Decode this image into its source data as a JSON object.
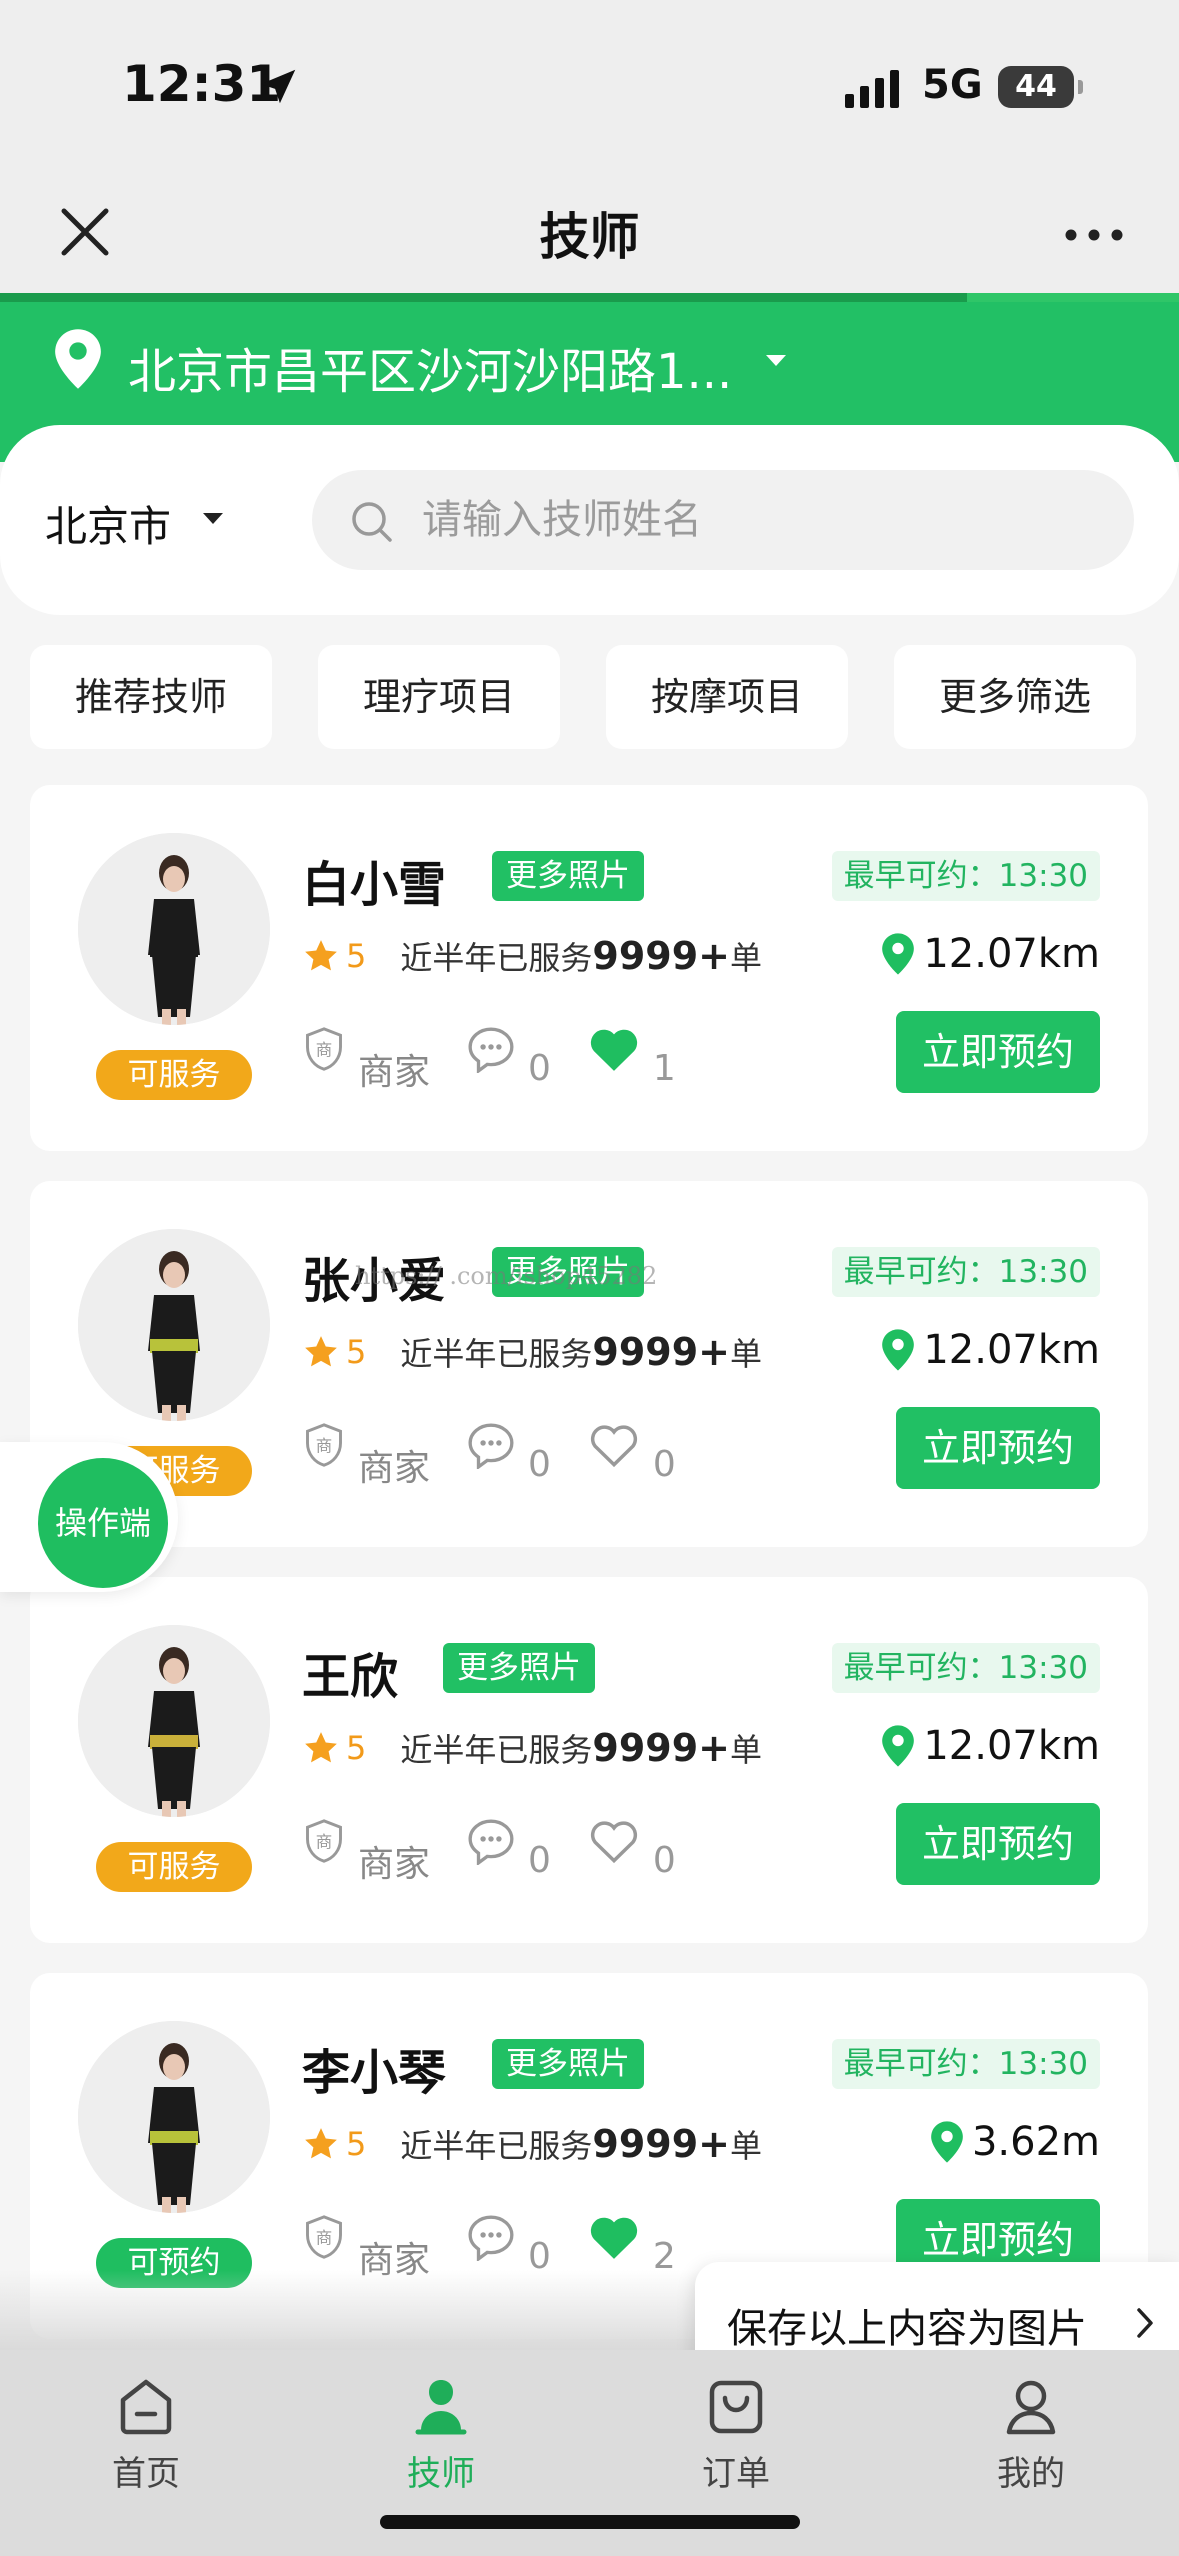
{
  "status_bar": {
    "time": "12:31",
    "network": "5G",
    "battery": "44"
  },
  "nav": {
    "title": "技师",
    "load_progress": 0.82
  },
  "location": {
    "address": "北京市昌平区沙河沙阳路1..."
  },
  "search": {
    "city": "北京市",
    "placeholder": "请输入技师姓名"
  },
  "filters": [
    "推荐技师",
    "理疗项目",
    "按摩项目",
    "更多筛选"
  ],
  "therapists": [
    {
      "name": "白小雪",
      "photo_tag": "更多照片",
      "earliest": "最早可约：13:30",
      "rating": "5",
      "served_prefix": "近半年已服务",
      "served_count": "9999+",
      "served_suffix": "单",
      "distance": "12.07km",
      "shop_label": "商家",
      "comments": "0",
      "likes": "1",
      "liked": true,
      "status": "可服务",
      "book_label": "立即预约",
      "colors": {
        "top": "#1b1b1b",
        "sash": "#1b1b1b"
      }
    },
    {
      "name": "张小爱",
      "photo_tag": "更多照片",
      "earliest": "最早可约：13:30",
      "rating": "5",
      "served_prefix": "近半年已服务",
      "served_count": "9999+",
      "served_suffix": "单",
      "distance": "12.07km",
      "shop_label": "商家",
      "comments": "0",
      "likes": "0",
      "liked": false,
      "status": "可服务",
      "book_label": "立即预约",
      "colors": {
        "top": "#1b1b1b",
        "sash": "#b8c23a"
      }
    },
    {
      "name": "王欣",
      "photo_tag": "更多照片",
      "earliest": "最早可约：13:30",
      "rating": "5",
      "served_prefix": "近半年已服务",
      "served_count": "9999+",
      "served_suffix": "单",
      "distance": "12.07km",
      "shop_label": "商家",
      "comments": "0",
      "likes": "0",
      "liked": false,
      "status": "可服务",
      "book_label": "立即预约",
      "colors": {
        "top": "#1b1b1b",
        "sash": "#c9b03a"
      }
    },
    {
      "name": "李小琴",
      "photo_tag": "更多照片",
      "earliest": "最早可约：13:30",
      "rating": "5",
      "served_prefix": "近半年已服务",
      "served_count": "9999+",
      "served_suffix": "单",
      "distance": "3.62m",
      "shop_label": "商家",
      "comments": "0",
      "likes": "2",
      "liked": true,
      "status": "可预约",
      "book_label": "立即预约",
      "colors": {
        "top": "#1b1b1b",
        "sash": "#b8c23a"
      }
    }
  ],
  "watermark": "https://        .com/ishop45282",
  "floating": {
    "operator": "操作端",
    "save_tip": "保存以上内容为图片"
  },
  "tabs": [
    {
      "label": "首页",
      "icon": "home-icon",
      "active": false
    },
    {
      "label": "技师",
      "icon": "therapist-icon",
      "active": true
    },
    {
      "label": "订单",
      "icon": "order-bag-icon",
      "active": false
    },
    {
      "label": "我的",
      "icon": "profile-icon",
      "active": false
    }
  ],
  "colors": {
    "brand_green": "#22c065",
    "status_orange": "#f2a81a",
    "earliest_tag_bg": "#e8f8ee",
    "earliest_tag_text": "#22b460",
    "active_tab": "#1fae59"
  }
}
